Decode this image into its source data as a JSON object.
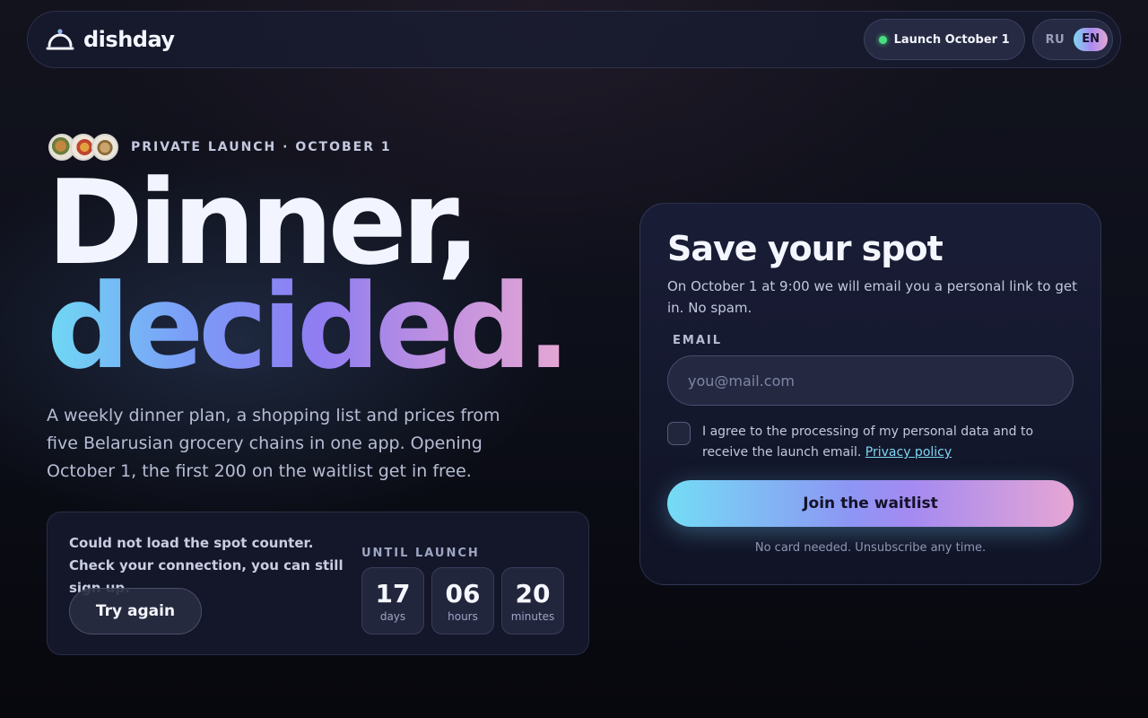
{
  "header": {
    "brand_name": "dishday",
    "launch_pill": "Launch October 1",
    "lang_ru": "RU",
    "lang_en": "EN",
    "active_language": "EN"
  },
  "hero": {
    "eyebrow": "PRIVATE LAUNCH · OCTOBER 1",
    "headline_line1": "Dinner,",
    "headline_line2": "decided.",
    "subtitle": "A weekly dinner plan, a shopping list and prices from five Belarusian grocery chains in one app. Opening October 1, the first 200 on the waitlist get in free."
  },
  "counter": {
    "error_message": "Could not load the spot counter. Check your connection, you can still sign up.",
    "retry_label": "Try again",
    "until_label": "UNTIL LAUNCH",
    "timer": [
      {
        "value": "17",
        "unit": "days"
      },
      {
        "value": "06",
        "unit": "hours"
      },
      {
        "value": "20",
        "unit": "minutes"
      }
    ]
  },
  "signup": {
    "title": "Save your spot",
    "description": "On October 1 at 9:00 we will email you a personal link to get in. No spam.",
    "email_label": "EMAIL",
    "email_placeholder": "you@mail.com",
    "email_value": "",
    "consent_text": "I agree to the processing of my personal data and to receive the launch email.",
    "privacy_link": "Privacy policy",
    "consent_checked": false,
    "submit_label": "Join the waitlist",
    "fineprint": "No card needed. Unsubscribe any time."
  },
  "colors": {
    "accent_cyan": "#6fd9f4",
    "accent_violet": "#8f7df2",
    "accent_pink": "#e6a7d4",
    "status_green": "#4ade80"
  },
  "icons": {
    "logo": "cloche-icon",
    "status": "status-dot-icon"
  }
}
